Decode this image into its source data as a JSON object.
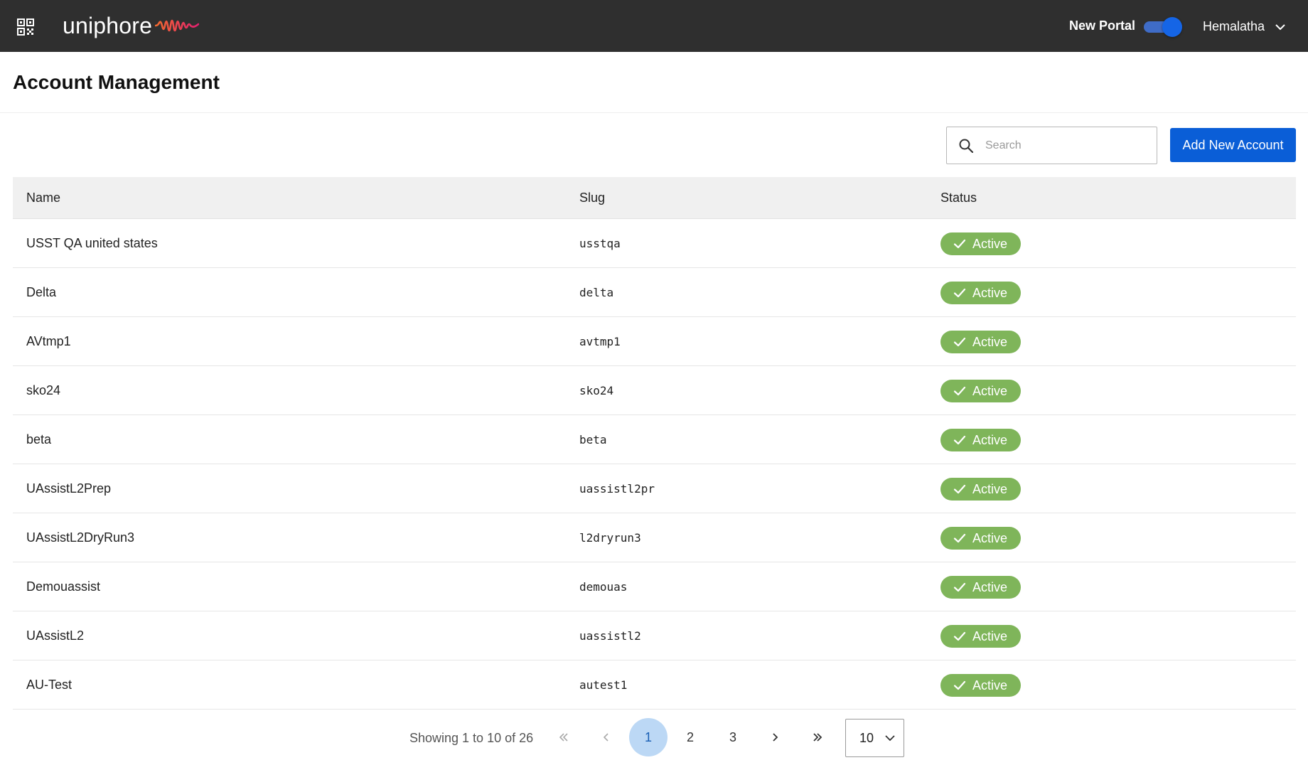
{
  "header": {
    "logo_text": "uniphore",
    "portal_label": "New Portal",
    "portal_toggle_on": true,
    "user_name": "Hemalatha"
  },
  "page": {
    "title": "Account Management"
  },
  "toolbar": {
    "search_placeholder": "Search",
    "add_label": "Add New Account"
  },
  "table": {
    "columns": [
      "Name",
      "Slug",
      "Status"
    ],
    "rows": [
      {
        "name": "USST QA united states",
        "slug": "usstqa",
        "status": "Active"
      },
      {
        "name": "Delta",
        "slug": "delta",
        "status": "Active"
      },
      {
        "name": "AVtmp1",
        "slug": "avtmp1",
        "status": "Active"
      },
      {
        "name": "sko24",
        "slug": "sko24",
        "status": "Active"
      },
      {
        "name": "beta",
        "slug": "beta",
        "status": "Active"
      },
      {
        "name": "UAssistL2Prep",
        "slug": "uassistl2pr",
        "status": "Active"
      },
      {
        "name": "UAssistL2DryRun3",
        "slug": "l2dryrun3",
        "status": "Active"
      },
      {
        "name": "Demouassist",
        "slug": "demouas",
        "status": "Active"
      },
      {
        "name": "UAssistL2",
        "slug": "uassistl2",
        "status": "Active"
      },
      {
        "name": "AU-Test",
        "slug": "autest1",
        "status": "Active"
      }
    ]
  },
  "pagination": {
    "showing": "Showing 1 to 10 of 26",
    "pages": [
      "1",
      "2",
      "3"
    ],
    "current_page": "1",
    "page_size": "10"
  },
  "colors": {
    "topbar": "#2f2f2f",
    "primary_button": "#0a5ed7",
    "status_active": "#7fb55a",
    "active_page": "#bcd8f5",
    "logo_wave_start": "#f26a2e",
    "logo_wave_end": "#e3206f"
  },
  "icons": {
    "apps": "qr-grid-icon",
    "search": "search-icon",
    "check": "check-icon",
    "user_menu": "chevron-down-icon"
  }
}
